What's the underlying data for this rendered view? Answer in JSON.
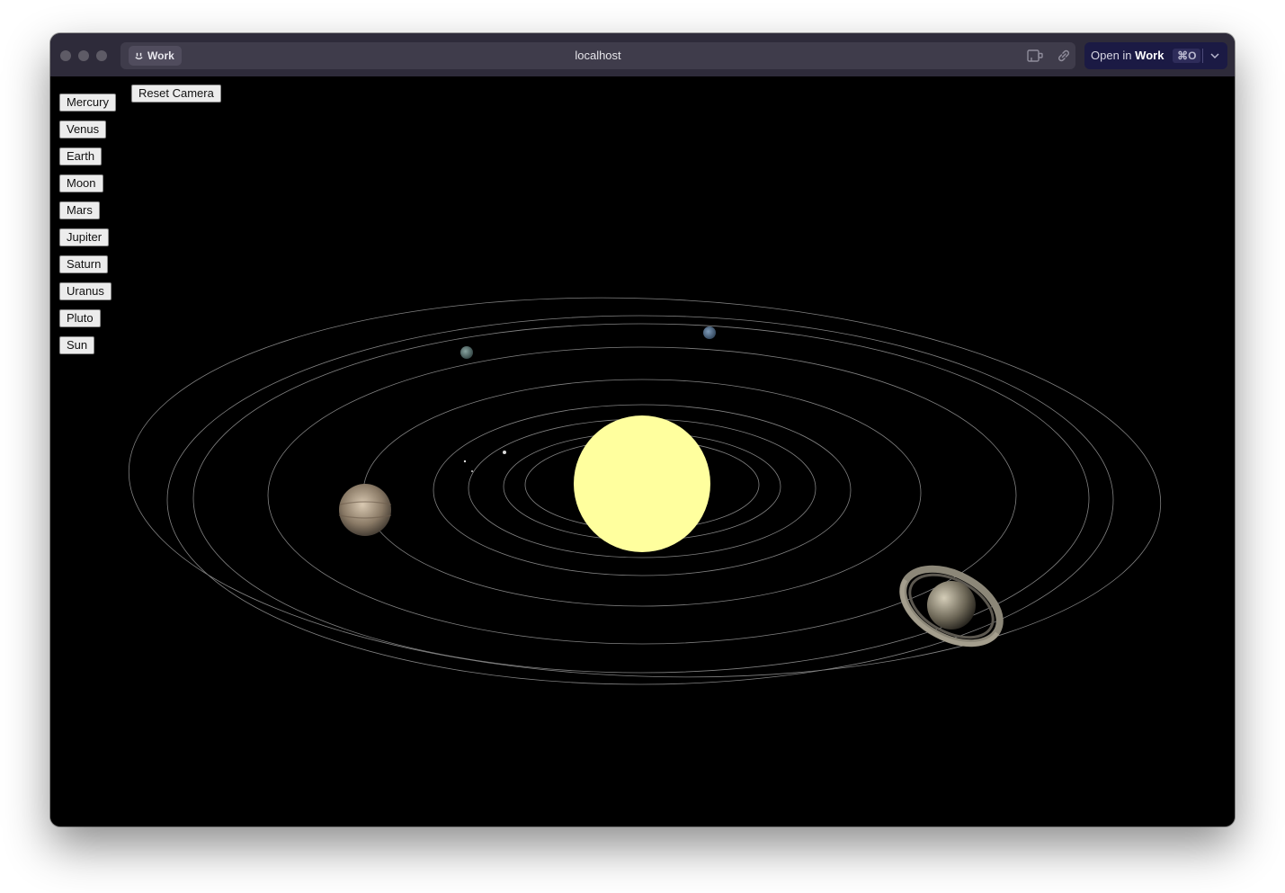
{
  "browser": {
    "profile_label": "Work",
    "url": "localhost",
    "open_in": {
      "prefix": "Open in",
      "target": "Work",
      "shortcut": "⌘O"
    }
  },
  "scene": {
    "reset_camera_label": "Reset Camera",
    "planet_buttons": [
      "Mercury",
      "Venus",
      "Earth",
      "Moon",
      "Mars",
      "Jupiter",
      "Saturn",
      "Uranus",
      "Pluto",
      "Sun"
    ],
    "colors": {
      "background": "#000000",
      "sun": "#ffff9e",
      "orbit": "#9a9a9a",
      "jupiter": "#b8a58f",
      "saturn": "#c8c0aa",
      "uranus": "#4a6a8a",
      "pluto": "#5a7a7a"
    }
  }
}
